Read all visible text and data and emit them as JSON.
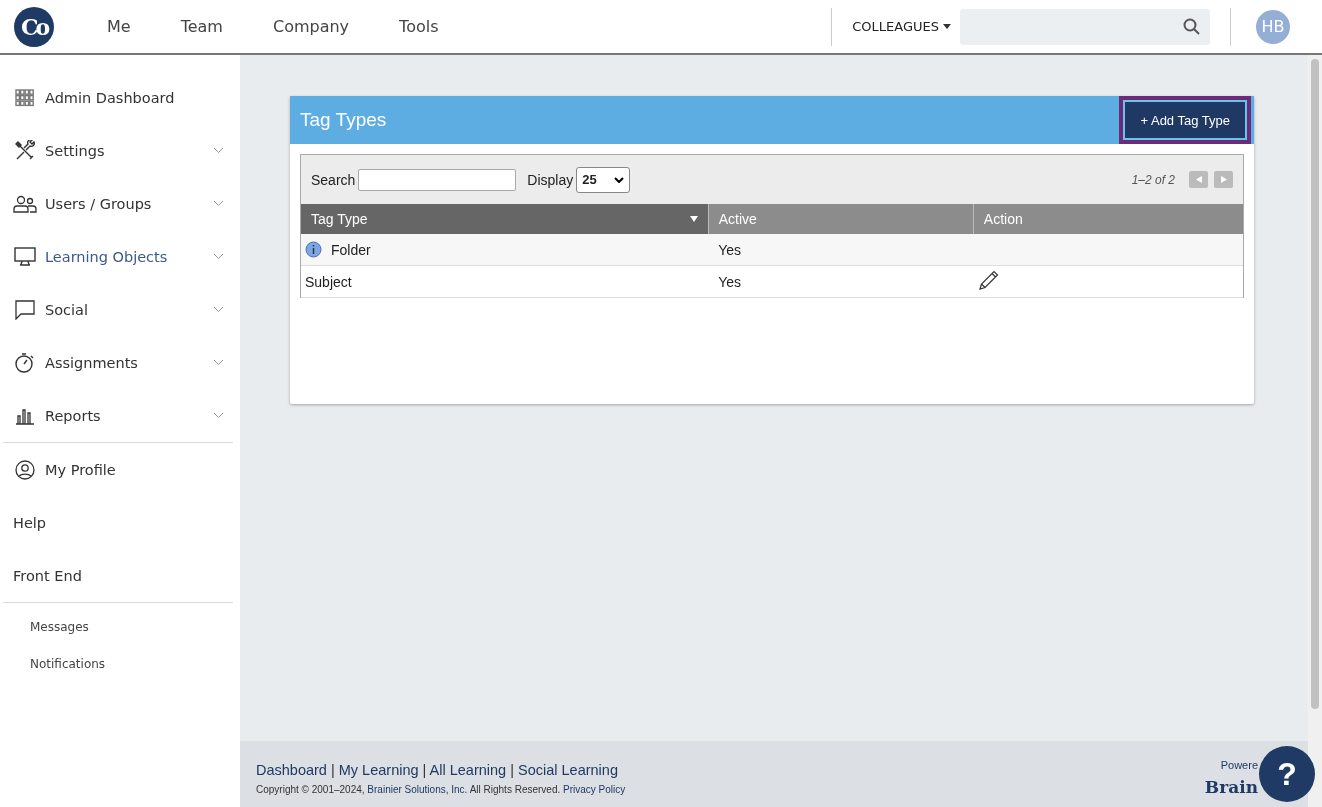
{
  "header": {
    "logo": "Co",
    "nav": [
      "Me",
      "Team",
      "Company",
      "Tools"
    ],
    "colleagues": "COLLEAGUES",
    "avatar": "HB"
  },
  "sidebar": {
    "groups": [
      [
        {
          "label": "Admin Dashboard",
          "kind": "grid",
          "expandable": false,
          "selected": false
        },
        {
          "label": "Settings",
          "kind": "tools",
          "expandable": true,
          "selected": false
        },
        {
          "label": "Users / Groups",
          "kind": "users",
          "expandable": true,
          "selected": false
        },
        {
          "label": "Learning Objects",
          "kind": "monitor",
          "expandable": true,
          "selected": true
        },
        {
          "label": "Social",
          "kind": "chat",
          "expandable": true,
          "selected": false
        },
        {
          "label": "Assignments",
          "kind": "timer",
          "expandable": true,
          "selected": false
        },
        {
          "label": "Reports",
          "kind": "bars",
          "expandable": true,
          "selected": false
        }
      ],
      [
        {
          "label": "My Profile",
          "kind": "profile",
          "expandable": false,
          "selected": false
        },
        {
          "label": "Help",
          "kind": "plain",
          "expandable": false,
          "selected": false
        },
        {
          "label": "Front End",
          "kind": "plain",
          "expandable": false,
          "selected": false
        }
      ]
    ],
    "sub_items": [
      "Messages",
      "Notifications"
    ]
  },
  "panel": {
    "title": "Tag Types",
    "add_button": "+ Add Tag Type",
    "search_label": "Search",
    "display_label": "Display",
    "display_value": "25",
    "pager": "1–2 of 2",
    "columns": [
      {
        "label": "Tag Type",
        "sorted": true
      },
      {
        "label": "Active",
        "sorted": false
      },
      {
        "label": "Action",
        "sorted": false
      }
    ],
    "rows": [
      {
        "name": "Folder",
        "active": "Yes",
        "info": true,
        "editable": false
      },
      {
        "name": "Subject",
        "active": "Yes",
        "info": false,
        "editable": true
      }
    ]
  },
  "footer": {
    "links": [
      "Dashboard",
      "My Learning",
      "All Learning",
      "Social Learning"
    ],
    "separator": "|",
    "copyright": "Copyright © 2001–2024,",
    "company": "Brainier Solutions, Inc.",
    "rights": "All Rights Reserved.",
    "privacy": "Privacy Policy",
    "powered": "Powere",
    "brand": "Brain"
  },
  "help_button": "?"
}
